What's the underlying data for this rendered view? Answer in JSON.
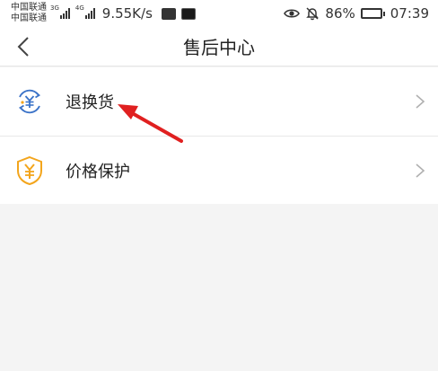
{
  "status_bar": {
    "carrier_1": "中国联通",
    "carrier_2": "中国联通",
    "net_1": "3G",
    "net_2": "4G",
    "speed": "9.55K/s",
    "battery_text": "86%",
    "battery_level": 0.86,
    "time": "07:39"
  },
  "nav": {
    "title": "售后中心"
  },
  "menu": {
    "items": [
      {
        "label": "退换货",
        "icon": "return-exchange-icon"
      },
      {
        "label": "价格保护",
        "icon": "price-protection-shield-icon"
      }
    ]
  },
  "colors": {
    "return_icon": "#3b73c8",
    "shield_icon": "#f3a51c",
    "arrow": "#e02020",
    "chevron": "#b0b0b0"
  }
}
